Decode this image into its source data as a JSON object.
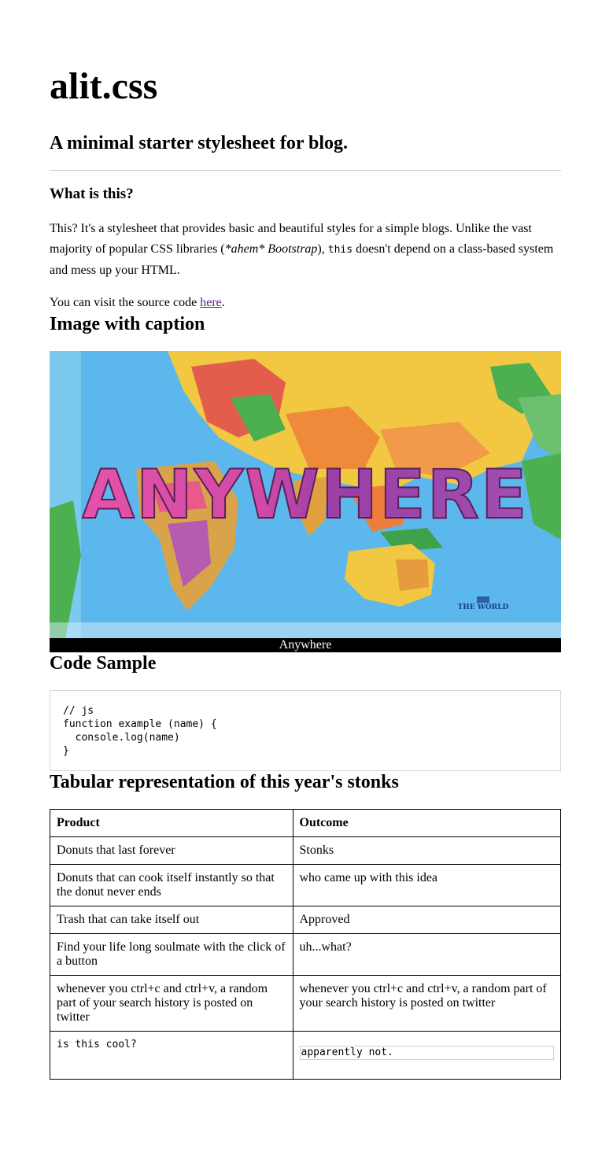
{
  "site": {
    "title": "alit.css",
    "tagline": "A minimal starter stylesheet for blog."
  },
  "about": {
    "heading": "What is this?",
    "p1_a": "This? It's a stylesheet that provides basic and beautiful styles for a simple blogs. Unlike the vast majority of popular CSS libraries (",
    "p1_em": "*ahem* Bootstrap",
    "p1_b": "), ",
    "p1_code": "this",
    "p1_c": " doesn't depend on a class-based system and mess up your HTML.",
    "p2_a": "You can visit the source code ",
    "p2_link": "here",
    "p2_b": "."
  },
  "image_section": {
    "heading": "Image with caption",
    "image_word": "ANYWHERE",
    "image_badge": "THE WORLD",
    "caption": "Anywhere"
  },
  "code_section": {
    "heading": "Code Sample",
    "lines": [
      "// js",
      "function example (name) {",
      "  console.log(name)",
      "}"
    ]
  },
  "table_section": {
    "heading": "Tabular representation of this year's stonks",
    "columns": [
      "Product",
      "Outcome"
    ],
    "rows": [
      [
        "Donuts that last forever",
        "Stonks"
      ],
      [
        "Donuts that can cook itself instantly so that the donut never ends",
        "who came up with this idea"
      ],
      [
        "Trash that can take itself out",
        "Approved"
      ],
      [
        "Find your life long soulmate with the click of a button",
        "uh...what?"
      ],
      [
        "whenever you ctrl+c and ctrl+v, a random part of your search history is posted on twitter",
        "whenever you ctrl+c and ctrl+v, a random part of your search history is posted on twitter"
      ]
    ],
    "last_row": [
      "is this cool?",
      "apparently not."
    ]
  },
  "colors": {
    "link": "#551a8b",
    "ocean": "#58b6ea",
    "word_pink": "#e453a8",
    "word_purple": "#9a3fa5"
  }
}
